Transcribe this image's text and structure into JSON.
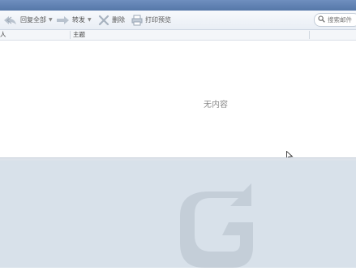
{
  "toolbar": {
    "reply_all": "回复全部",
    "forward": "转发",
    "delete": "删除",
    "print_preview": "打印预览"
  },
  "search": {
    "placeholder": "搜索邮件"
  },
  "columns": {
    "from": "人",
    "subject": "主题"
  },
  "list": {
    "empty_text": "无内容"
  },
  "icons": {
    "reply_all": "reply-all-icon",
    "forward": "forward-icon",
    "delete": "delete-icon",
    "print": "print-icon",
    "search": "search-icon",
    "logo": "app-logo"
  },
  "colors": {
    "titlebar": "#5c7fb3",
    "preview_bg": "#d8e1ea",
    "logo": "#c4ced8"
  }
}
